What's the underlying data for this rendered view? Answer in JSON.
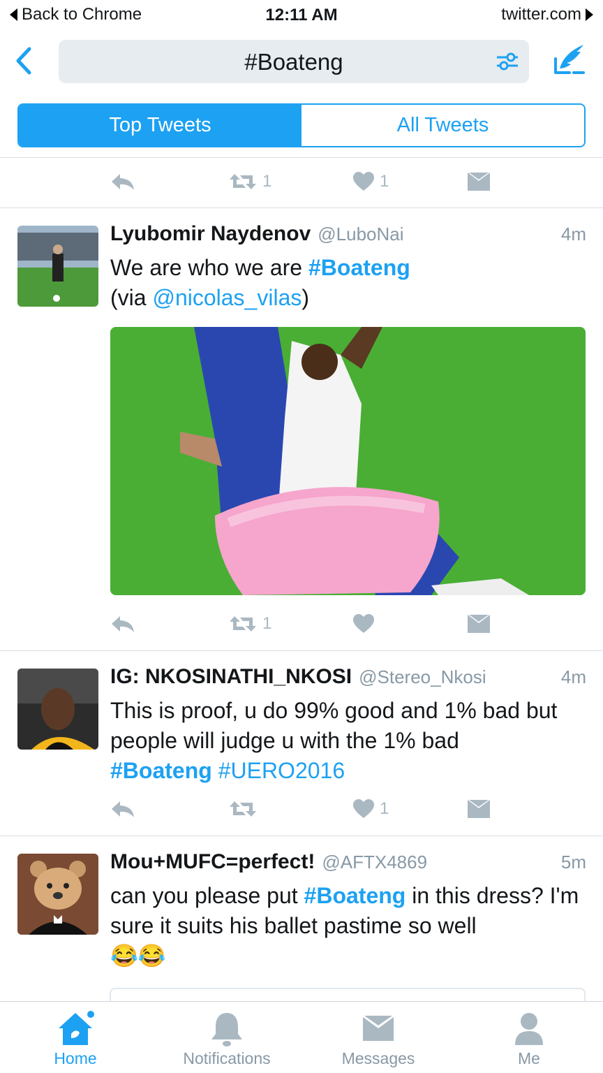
{
  "status_bar": {
    "back_label": "Back to Chrome",
    "time": "12:11 AM",
    "site": "twitter.com"
  },
  "search": {
    "query": "#Boateng"
  },
  "tabs": {
    "top": "Top Tweets",
    "all": "All Tweets"
  },
  "first_actions": {
    "retweets": "1",
    "likes": "1"
  },
  "tweets": [
    {
      "name": "Lyubomir Naydenov",
      "handle": "@LuboNai",
      "time": "4m",
      "text_parts": [
        "We are who we are ",
        "#Boateng",
        "(via ",
        "@nicolas_vilas",
        ")"
      ],
      "retweets": "1",
      "likes": ""
    },
    {
      "name": "IG: NKOSINATHI_NKOSI",
      "handle": "@Stereo_Nkosi",
      "time": "4m",
      "text_parts": [
        "This is proof, u do 99% good and 1% bad but people will judge u with the 1% bad",
        "#Boateng",
        "#UERO2016"
      ],
      "retweets": "",
      "likes": "1"
    },
    {
      "name": "Mou+MUFC=perfect!",
      "handle": "@AFTX4869",
      "time": "5m",
      "text_parts": [
        "can you please put ",
        "#Boateng",
        " in this dress? I'm sure it suits his ballet pastime so well",
        "😂😂"
      ]
    }
  ],
  "tabbar": {
    "home": "Home",
    "notifications": "Notifications",
    "messages": "Messages",
    "me": "Me"
  },
  "colors": {
    "accent": "#1da1f2",
    "muted": "#8899a6",
    "icon": "#aab8c2"
  }
}
